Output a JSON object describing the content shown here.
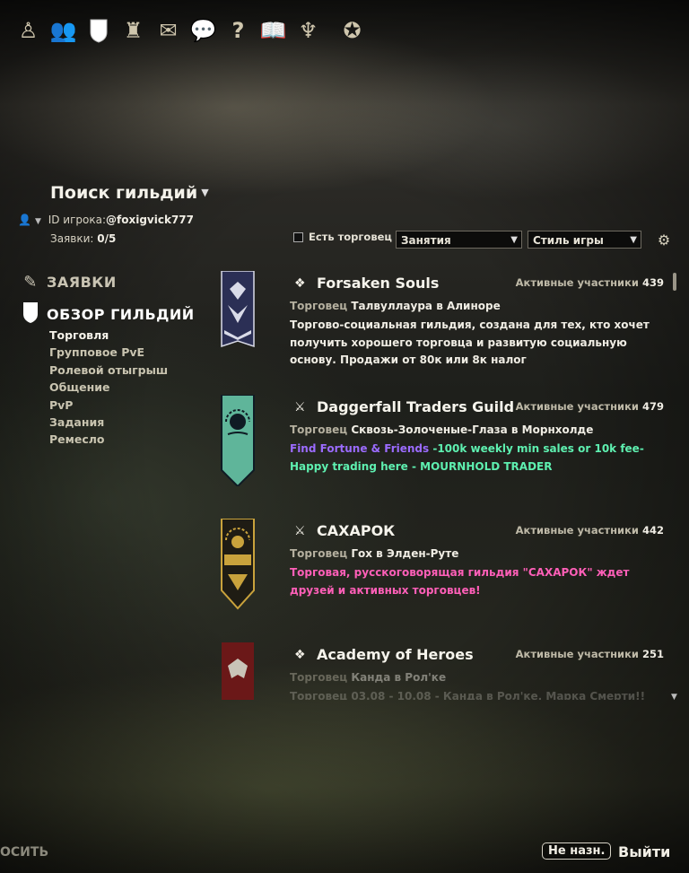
{
  "topbar": {
    "icons": [
      "character-icon",
      "group-icon",
      "guild-shield-icon",
      "alliance-tower-icon",
      "mail-icon",
      "chat-icon",
      "help-icon",
      "journal-icon",
      "skills-icon",
      "champion-icon"
    ]
  },
  "header": {
    "title": "Поиск гильдий",
    "player_id_label": "ID игрока:",
    "player_id_value": "@foxigvick777",
    "applications_label": "Заявки:",
    "applications_value": "0/5"
  },
  "nav": {
    "applications": "ЗАЯВКИ",
    "overview": "ОБЗОР ГИЛЬДИЙ",
    "categories": [
      "Торговля",
      "Групповое PvE",
      "Ролевой отыгрыш",
      "Общение",
      "PvP",
      "Задания",
      "Ремесло"
    ],
    "selected_category": "Торговля"
  },
  "filters": {
    "has_trader": "Есть торговец",
    "activities": "Занятия",
    "playstyle": "Стиль игры"
  },
  "guilds": [
    {
      "name": "Forsaken Souls",
      "members_label": "Активные участники",
      "members": "439",
      "trader_label": "Торговец",
      "trader": "Талвуллаура в Алиноре",
      "description": "Торгово-социальная гильдия, создана для тех, кто хочет получить хорошего торговца и развитую социальную основу. Продажи от 80к или 8к налог",
      "desc_color": "#f0ede4",
      "banner_color": "#2b2f55",
      "banner_accent": "#d9dbe8"
    },
    {
      "name": "Daggerfall Traders Guild",
      "members_label": "Активные участники",
      "members": "479",
      "trader_label": "Торговец",
      "trader": "Сквозь-Золоченые-Глаза в Морнхолде",
      "description_part1": "Find Fortune & Friends",
      "description_part2": " -100k weekly min sales or 10k fee- Happy trading here - MOURNHOLD TRADER",
      "desc_color1": "#9b6bff",
      "desc_color2": "#5ef0b0",
      "banner_color": "#5fb59a",
      "banner_accent": "#0f1b24"
    },
    {
      "name": "САХАРОК",
      "members_label": "Активные участники",
      "members": "442",
      "trader_label": "Торговец",
      "trader": "Гох в Элден-Руте",
      "description": "Торговая, русскоговорящая гильдия \"САХАРОК\" ждет друзей и активных торговцев!",
      "desc_color": "#ff5fb8",
      "banner_color": "#1f1c14",
      "banner_accent": "#c9a23c"
    },
    {
      "name": "Academy of Heroes",
      "members_label": "Активные участники",
      "members": "251",
      "trader_label": "Торговец",
      "trader": "Канда в Рол'ке",
      "description": "Торговец 03.08 - 10.08 - Канда в Рол'ке, Марка Смерти!!",
      "desc_color": "#f0ede4",
      "banner_color": "#6b1818",
      "banner_accent": "#c9c4b8"
    }
  ],
  "footer": {
    "left_text": "ОСИТЬ",
    "key_hint": "Не назн.",
    "exit": "Выйти"
  }
}
